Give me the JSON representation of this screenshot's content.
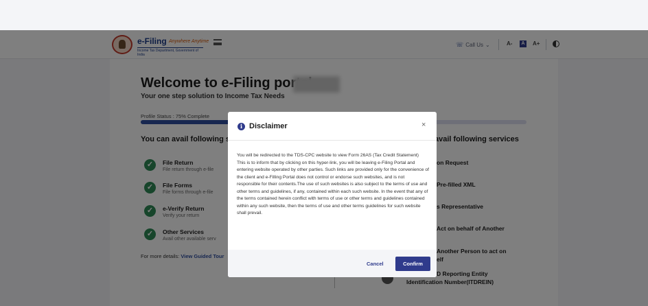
{
  "header": {
    "logo_title": "e-Filing",
    "logo_tagline": "Anywhere Anytime",
    "logo_subtitle": "Income Tax Department, Government of India",
    "call_us_label": "Call Us",
    "font_decrease_label": "A-",
    "font_normal_label": "A",
    "font_increase_label": "A+"
  },
  "page": {
    "welcome": "Welcome to e-Filing portal",
    "tagline": "Your one step solution to Income Tax Needs",
    "profile_status": "Profile Status : 75% Complete",
    "profile_progress_percent": 75,
    "left_heading": "You can avail following s",
    "right_heading": "avail following services",
    "left_services": [
      {
        "title": "File Return",
        "desc": "File return through e-file"
      },
      {
        "title": "File Forms",
        "desc": "File forms through e-file"
      },
      {
        "title": "e-Verify Return",
        "desc": "Verify your return"
      },
      {
        "title": "Other Services",
        "desc": "Avail other available serv"
      }
    ],
    "more_details_prefix": "For more details:",
    "more_details_link": "View Guided Tour",
    "right_services": [
      "on Request",
      "Pre-filled XML",
      "s Representative",
      "Act on behalf of Another",
      "Another Person to act on",
      "elf",
      "D Reporting Entity",
      "Identification Number(ITDREIN)"
    ]
  },
  "modal": {
    "title": "Disclaimer",
    "close_symbol": "×",
    "body": "You will be redirected to the TDS-CPC website to view Form 26AS (Tax Credit Statement)\nThis is to inform that by clicking on this hyper-link, you will be leaving e-Filing Portal and entering website operated by other parties. Such links are provided only for the convenience of the client and e-Filling Portal does not control or endorse such websites, and is not responsible for their contents.The use of such websites is also subject to the terms of use and other terms and guidelines, if any, contained within each such website. In the event that any of the terms contained herein conflict with terms of use or other terms and guidelines contained within any such website, then the terms of use and other terms guidelines for such website shall prevail.",
    "cancel_label": "Cancel",
    "confirm_label": "Confirm"
  },
  "colors": {
    "primary": "#2f3b8c",
    "success": "#2e8b57",
    "overlay": "rgba(0,0,0,0.5)"
  }
}
